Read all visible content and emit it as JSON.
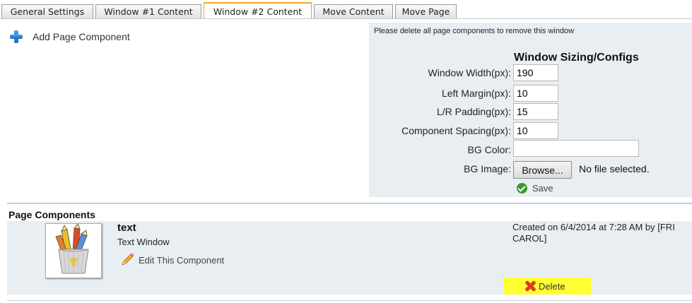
{
  "tabs": [
    {
      "label": "General Settings",
      "active": false
    },
    {
      "label": "Window #1 Content",
      "active": false
    },
    {
      "label": "Window #2 Content",
      "active": true
    },
    {
      "label": "Move Content",
      "active": false
    },
    {
      "label": "Move Page",
      "active": false
    }
  ],
  "add_component": {
    "label": "Add Page Component",
    "icon": "plus-icon"
  },
  "config": {
    "notice": "Please delete all page components to remove this window",
    "title": "Window Sizing/Configs",
    "fields": {
      "window_width": {
        "label": "Window Width(px):",
        "value": "190"
      },
      "left_margin": {
        "label": "Left Margin(px):",
        "value": "10"
      },
      "lr_padding": {
        "label": "L/R Padding(px):",
        "value": "15"
      },
      "component_spacing": {
        "label": "Component Spacing(px):",
        "value": "10"
      },
      "bg_color": {
        "label": "BG Color:",
        "value": ""
      },
      "bg_image": {
        "label": "BG Image:",
        "button": "Browse...",
        "status": "No file selected."
      }
    },
    "save_label": "Save"
  },
  "components": {
    "title": "Page Components",
    "items": [
      {
        "name": "text",
        "type": "Text Window",
        "edit_label": "Edit This Component",
        "created": "Created on 6/4/2014 at 7:28 AM by [FRI CAROL]",
        "delete_label": "Delete"
      }
    ]
  },
  "colors": {
    "panel_bg": "#e9eef3",
    "active_tab_border": "#f0a830",
    "highlight": "#ffff33",
    "delete_icon": "#e0391b",
    "save_icon": "#3b9a2a"
  }
}
